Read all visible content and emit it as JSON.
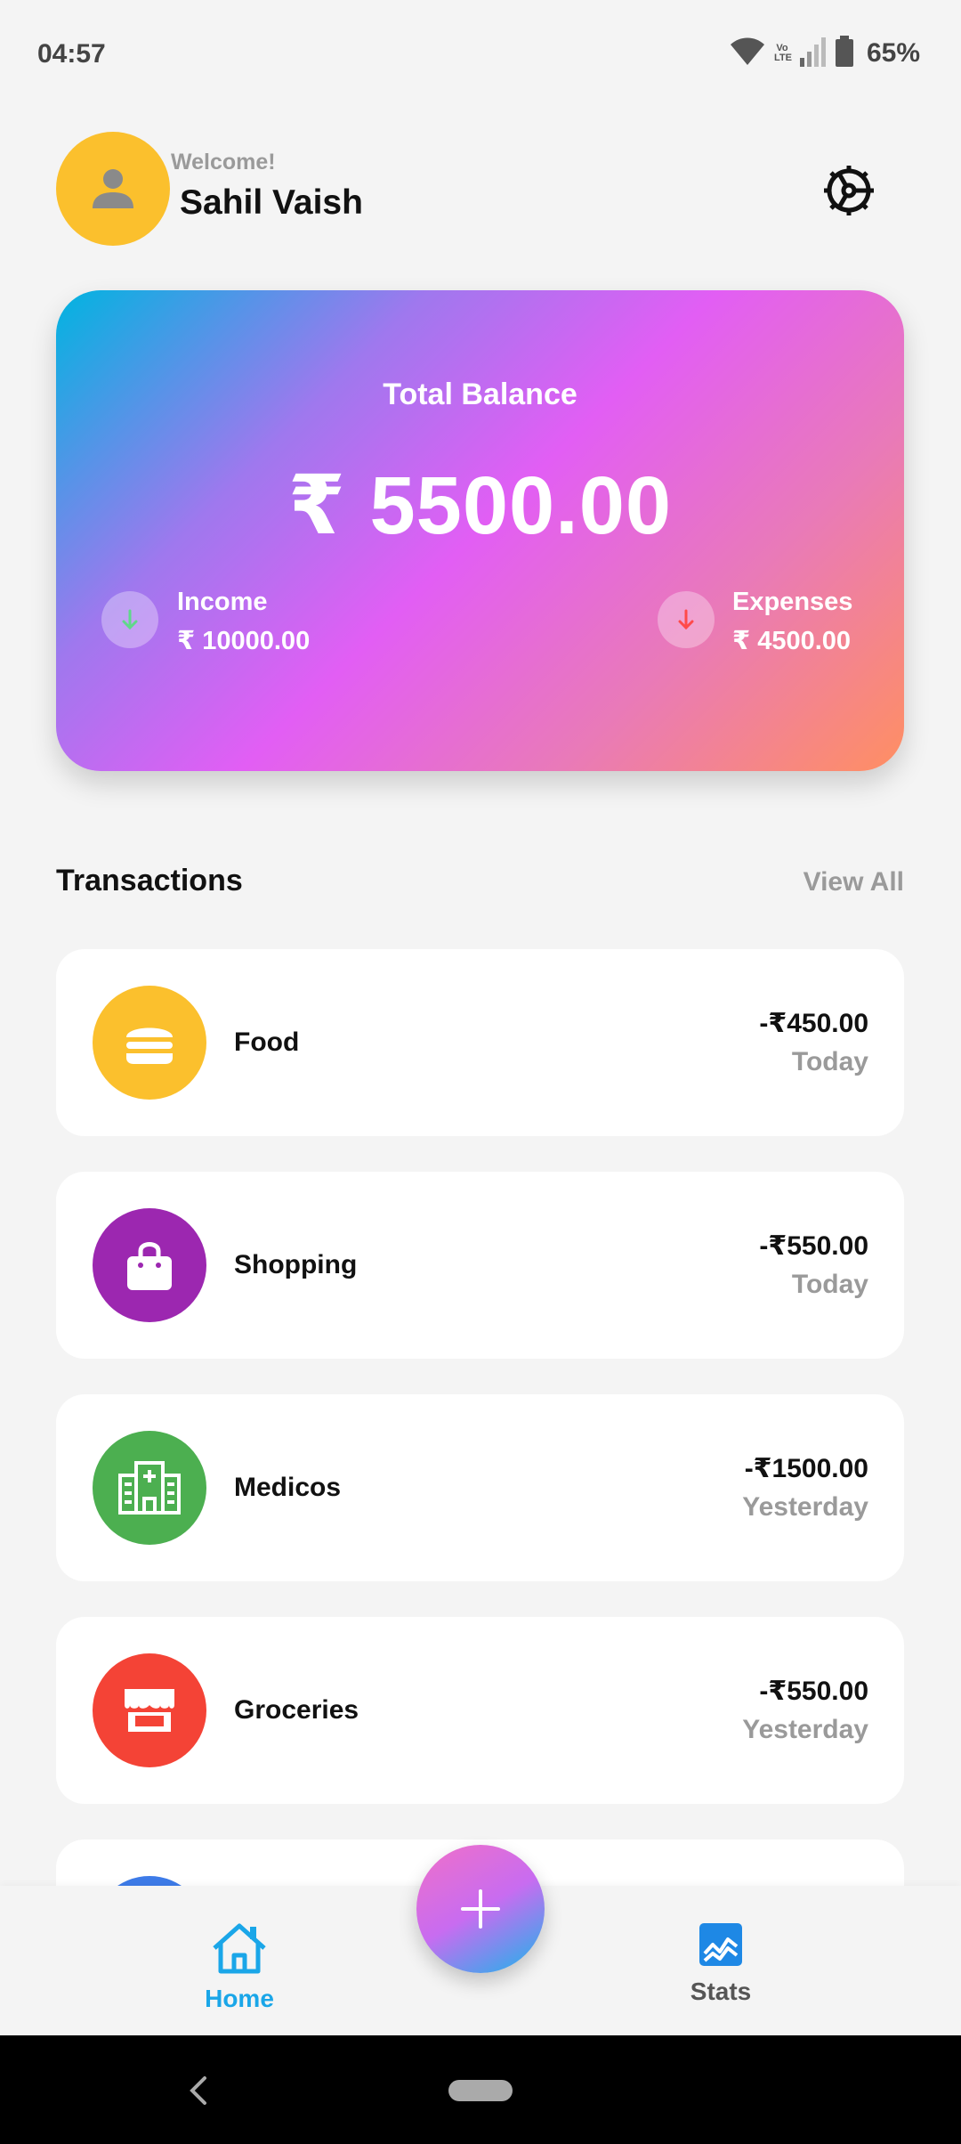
{
  "status_bar": {
    "time": "04:57",
    "lte_label": "Vo LTE",
    "battery_percent": "65%",
    "icons": [
      "wifi-icon",
      "volte-icon",
      "signal-icon",
      "battery-icon"
    ]
  },
  "header": {
    "welcome": "Welcome!",
    "user_name": "Sahil Vaish",
    "avatar_color": "#fbc02d"
  },
  "balance_card": {
    "title": "Total Balance",
    "amount": "₹ 5500.00",
    "income": {
      "label": "Income",
      "value": "₹ 10000.00",
      "icon_color": "#5fd88a"
    },
    "expenses": {
      "label": "Expenses",
      "value": "₹ 4500.00",
      "icon_color": "#ff4a4a"
    }
  },
  "transactions": {
    "title": "Transactions",
    "view_all": "View All",
    "items": [
      {
        "name": "Food",
        "amount": "-₹450.00",
        "date": "Today",
        "icon": "burger-icon",
        "color": "#fbc02d"
      },
      {
        "name": "Shopping",
        "amount": "-₹550.00",
        "date": "Today",
        "icon": "shopping-bag-icon",
        "color": "#9c27b0"
      },
      {
        "name": "Medicos",
        "amount": "-₹1500.00",
        "date": "Yesterday",
        "icon": "hospital-icon",
        "color": "#4caf50"
      },
      {
        "name": "Groceries",
        "amount": "-₹550.00",
        "date": "Yesterday",
        "icon": "store-icon",
        "color": "#f44336"
      }
    ]
  },
  "bottom_nav": {
    "home_label": "Home",
    "stats_label": "Stats",
    "active_color": "#1aa6e8",
    "inactive_color": "#555555"
  }
}
